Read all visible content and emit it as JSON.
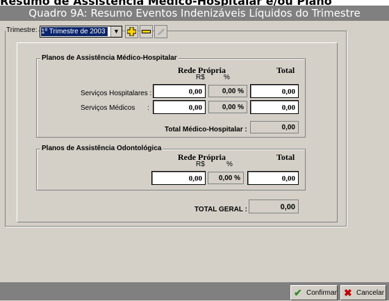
{
  "header": {
    "clipped_title": "Resumo de Assistência Médico-Hospitalar e/ou Plano",
    "window_title": "Quadro 9A: Resumo Eventos Indenizáveis Líquidos do Trimestre"
  },
  "toolbar": {
    "trimestre_label": "Trimestre:",
    "trimestre_value": "1º Trimestre de 2003",
    "icons": [
      "dropdown-arrow",
      "add-icon",
      "remove-icon",
      "edit-icon"
    ]
  },
  "medico": {
    "title": "Planos de Assistência Médico-Hospitalar",
    "col_rede": "Rede Própria",
    "col_rs": "R$",
    "col_pct": "%",
    "col_total": "Total",
    "rows": [
      {
        "label": "Serviços Hospitalares :",
        "value": "0,00",
        "pct": "0,00 %",
        "total": "0,00"
      },
      {
        "label": "Serviços Médicos",
        "colon": ":",
        "value": "0,00",
        "pct": "0,00 %",
        "total": "0,00"
      }
    ],
    "total_label": "Total Médico-Hospitalar :",
    "total_value": "0,00"
  },
  "odonto": {
    "title": "Planos de Assistência Odontológica",
    "col_rede": "Rede Própria",
    "col_rs": "R$",
    "col_pct": "%",
    "col_total": "Total",
    "value": "0,00",
    "pct": "0,00 %",
    "total": "0,00"
  },
  "grand_total": {
    "label": "TOTAL GERAL :",
    "value": "0,00"
  },
  "buttons": {
    "confirm": "Confirmar",
    "cancel": "Cancelar"
  },
  "colors": {
    "titlebar": "#808080",
    "selection": "#0a246a",
    "confirm_icon": "#2e8b2e",
    "cancel_icon": "#c00000"
  }
}
